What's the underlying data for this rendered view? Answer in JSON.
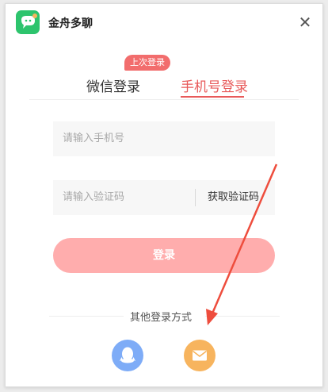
{
  "app": {
    "name": "金舟多聊"
  },
  "tabs": [
    {
      "label": "微信登录"
    },
    {
      "label": "手机号登录"
    }
  ],
  "badge": {
    "last_login": "上次登录"
  },
  "form": {
    "phone_placeholder": "请输入手机号",
    "code_placeholder": "请输入验证码",
    "get_code": "获取验证码",
    "login": "登录"
  },
  "other": {
    "label": "其他登录方式"
  },
  "colors": {
    "accent": "#e85a5a",
    "login_button": "#ffadad",
    "qq": "#7eacf7",
    "mail": "#f7b45e",
    "logo": "#2dc46d"
  },
  "icons": [
    "app-logo-icon",
    "close-icon",
    "qq-icon",
    "mail-icon"
  ]
}
